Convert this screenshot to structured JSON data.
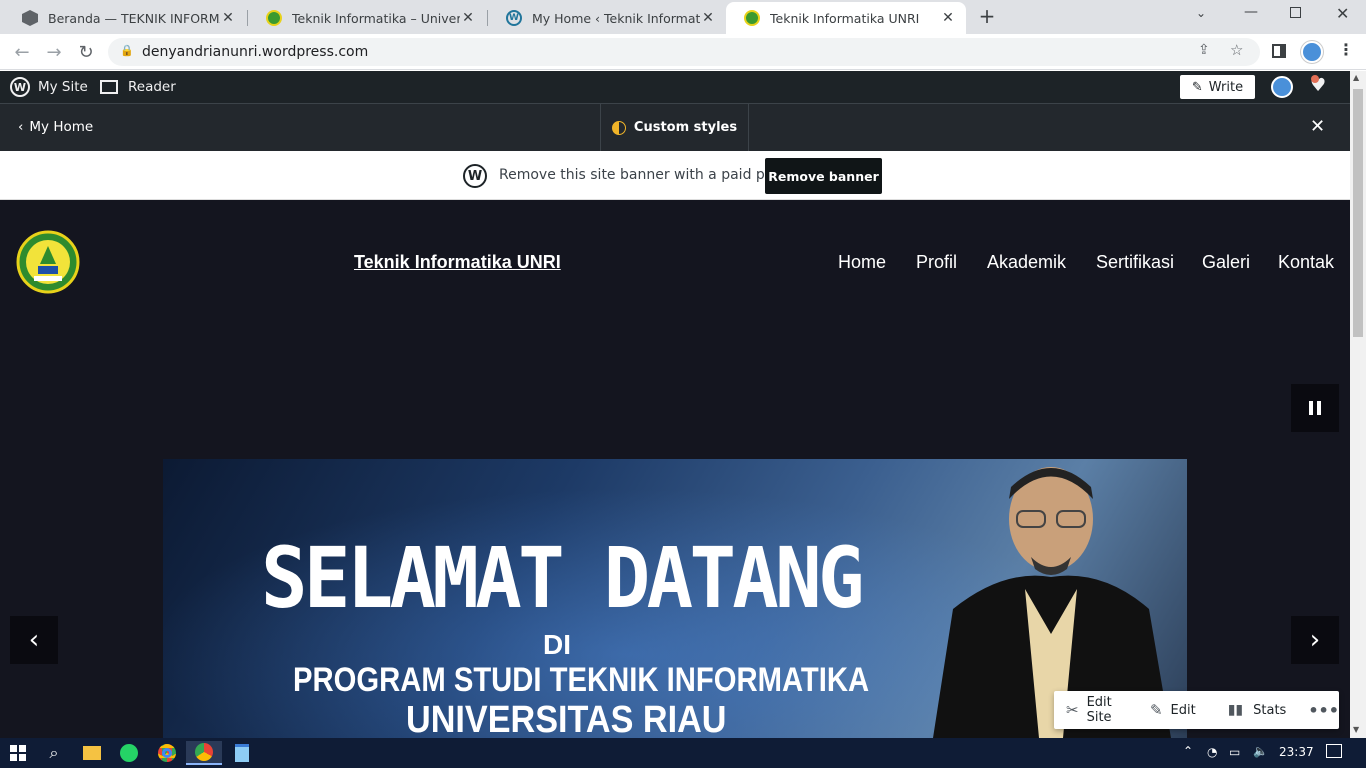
{
  "browser": {
    "tabs": [
      {
        "title": "Beranda — TEKNIK INFORMATIKA",
        "icon": "cube-icon",
        "active": false
      },
      {
        "title": "Teknik Informatika – Universitas R",
        "icon": "unri-logo-icon",
        "active": false
      },
      {
        "title": "My Home ‹ Teknik Informatika UI",
        "icon": "wordpress-icon",
        "active": false
      },
      {
        "title": "Teknik Informatika UNRI",
        "icon": "unri-logo-icon",
        "active": true
      }
    ],
    "url": "denyandrianunri.wordpress.com"
  },
  "wp_admin_bar": {
    "my_site": "My Site",
    "reader": "Reader",
    "write": "Write"
  },
  "customizer": {
    "back_label": "My Home",
    "custom_styles": "Custom styles"
  },
  "banner": {
    "text": "Remove this site banner with a paid plan",
    "button": "Remove banner"
  },
  "site": {
    "title": "Teknik Informatika UNRI",
    "nav": [
      "Home",
      "Profil",
      "Akademik",
      "Sertifikasi",
      "Galeri",
      "Kontak"
    ],
    "slide": {
      "line1": "SELAMAT DATANG",
      "line2": "DI",
      "line3": "PROGRAM STUDI TEKNIK INFORMATIKA",
      "line4": "UNIVERSITAS RIAU"
    }
  },
  "floating_toolbar": {
    "edit_site": "Edit Site",
    "edit": "Edit",
    "stats": "Stats"
  },
  "taskbar": {
    "time": "23:37"
  },
  "colors": {
    "site_bg": "#14151f",
    "wp_bar": "#1d2327",
    "accent_orange": "#f0b429"
  }
}
